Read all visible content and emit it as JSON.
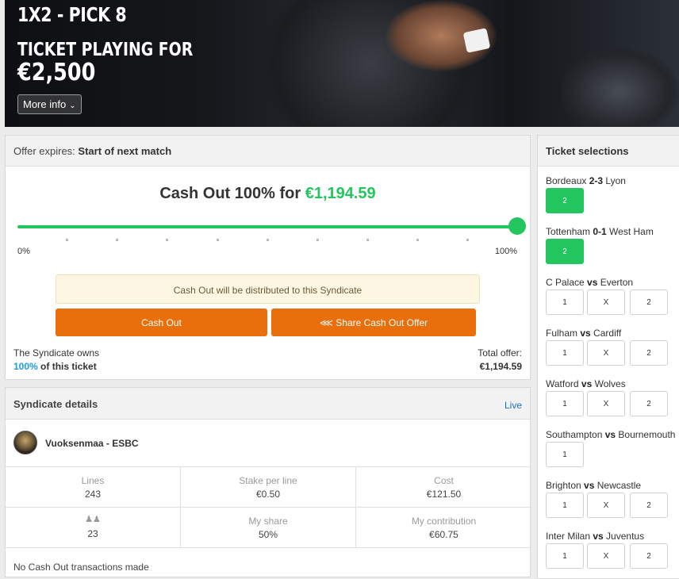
{
  "hero": {
    "title": "1X2 - PICK 8",
    "playing_for": "TICKET PLAYING FOR",
    "amount": "€2,500",
    "more_info": "More info"
  },
  "offer": {
    "expires_label": "Offer expires:",
    "expires_value": "Start of next match",
    "title_prefix": "Cash Out 100% for",
    "title_amount": "€1,194.59",
    "slider_value_percent": 100,
    "slider_min": "0%",
    "slider_max": "100%",
    "distribution_note": "Cash Out will be distributed to this Syndicate",
    "cashout_button": "Cash Out",
    "share_button": "Share Cash Out Offer",
    "owns_line1": "The Syndicate owns",
    "owns_pct": "100%",
    "owns_rest": "of this ticket",
    "total_label": "Total offer:",
    "total_value": "€1,194.59"
  },
  "syndicate": {
    "title": "Syndicate details",
    "live": "Live",
    "user_name": "Vuoksenmaa - ESBC",
    "stats": [
      {
        "label": "Lines",
        "value": "243"
      },
      {
        "label": "Stake per line",
        "value": "€0.50"
      },
      {
        "label": "Cost",
        "value": "€121.50"
      },
      {
        "label": "",
        "value": "23"
      },
      {
        "label": "My share",
        "value": "50%"
      },
      {
        "label": "My contribution",
        "value": "€60.75"
      }
    ],
    "no_transactions": "No Cash Out transactions made"
  },
  "selections": {
    "title": "Ticket selections",
    "matches": [
      {
        "home": "Bordeaux",
        "score": "2-3",
        "away": "Lyon",
        "picks": [
          "2"
        ],
        "selected": [
          "2"
        ]
      },
      {
        "home": "Tottenham",
        "score": "0-1",
        "away": "West Ham",
        "picks": [
          "2"
        ],
        "selected": [
          "2"
        ]
      },
      {
        "home": "C Palace",
        "score": "vs",
        "away": "Everton",
        "picks": [
          "1",
          "X",
          "2"
        ],
        "selected": []
      },
      {
        "home": "Fulham",
        "score": "vs",
        "away": "Cardiff",
        "picks": [
          "1",
          "X",
          "2"
        ],
        "selected": []
      },
      {
        "home": "Watford",
        "score": "vs",
        "away": "Wolves",
        "picks": [
          "1",
          "X",
          "2"
        ],
        "selected": []
      },
      {
        "home": "Southampton",
        "score": "vs",
        "away": "Bournemouth",
        "picks": [
          "1"
        ],
        "selected": []
      },
      {
        "home": "Brighton",
        "score": "vs",
        "away": "Newcastle",
        "picks": [
          "1",
          "X",
          "2"
        ],
        "selected": []
      },
      {
        "home": "Inter Milan",
        "score": "vs",
        "away": "Juventus",
        "picks": [
          "1",
          "X",
          "2"
        ],
        "selected": []
      }
    ]
  },
  "colors": {
    "accent_green": "#22c55e",
    "button_orange": "#e86f0b",
    "link_blue": "#1e9bd7"
  }
}
